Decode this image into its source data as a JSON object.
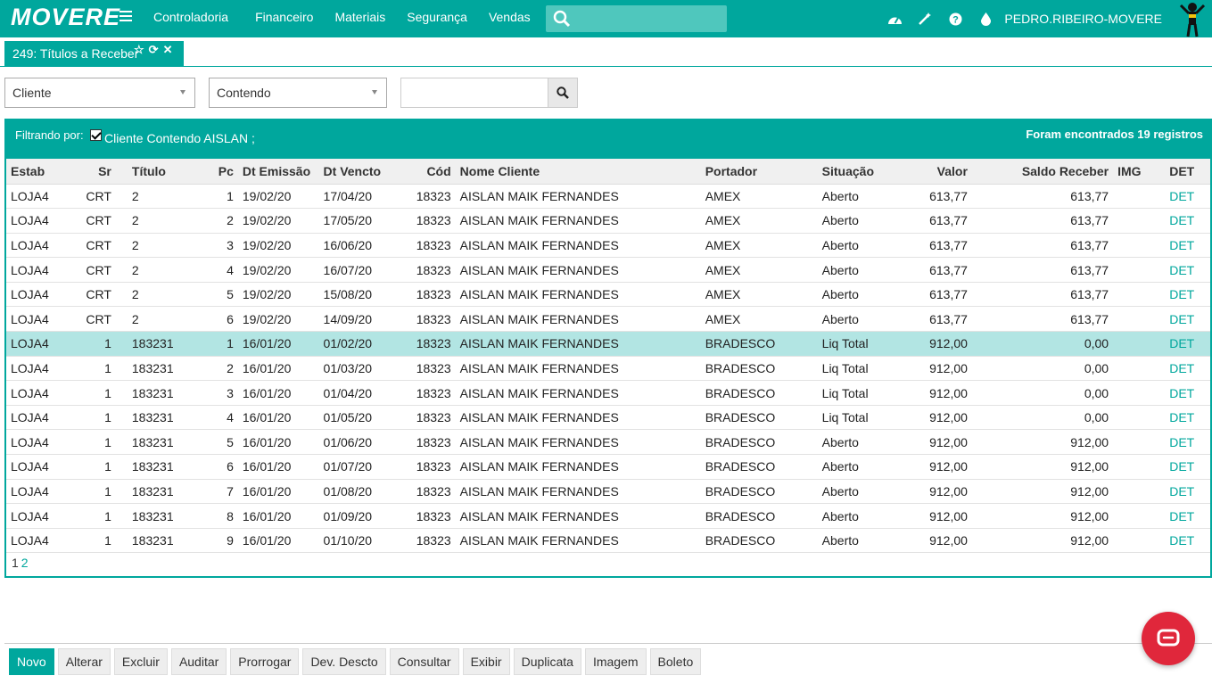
{
  "app": {
    "logo": "MOVERE",
    "user": "PEDRO.RIBEIRO-MOVERE"
  },
  "nav": {
    "items": [
      "Controladoria",
      "Financeiro",
      "Materiais",
      "Segurança",
      "Vendas"
    ],
    "search_placeholder": ""
  },
  "icons": {
    "dashboard": "dashboard-icon",
    "magic": "magic-wand-icon",
    "help": "help-icon",
    "drop": "drop-icon"
  },
  "tab": {
    "label": "249: Títulos a Receber"
  },
  "filters": {
    "field": "Cliente",
    "operator": "Contendo",
    "value": ""
  },
  "panel": {
    "filter_label": "Filtrando por:",
    "filter_chip": "Cliente Contendo AISLAN ;",
    "found": "Foram encontrados 19 registros"
  },
  "table": {
    "columns": [
      "Estab",
      "Sr",
      "Título",
      "Pc",
      "Dt Emissão",
      "Dt Vencto",
      "Cód",
      "Nome Cliente",
      "Portador",
      "Situação",
      "Valor",
      "Saldo Receber",
      "IMG",
      "DET"
    ],
    "rows": [
      [
        "LOJA4",
        "CRT",
        "2",
        "1",
        "19/02/20",
        "17/04/20",
        "18323",
        "AISLAN MAIK FERNANDES",
        "AMEX",
        "Aberto",
        "613,77",
        "613,77",
        "",
        "DET"
      ],
      [
        "LOJA4",
        "CRT",
        "2",
        "2",
        "19/02/20",
        "17/05/20",
        "18323",
        "AISLAN MAIK FERNANDES",
        "AMEX",
        "Aberto",
        "613,77",
        "613,77",
        "",
        "DET"
      ],
      [
        "LOJA4",
        "CRT",
        "2",
        "3",
        "19/02/20",
        "16/06/20",
        "18323",
        "AISLAN MAIK FERNANDES",
        "AMEX",
        "Aberto",
        "613,77",
        "613,77",
        "",
        "DET"
      ],
      [
        "LOJA4",
        "CRT",
        "2",
        "4",
        "19/02/20",
        "16/07/20",
        "18323",
        "AISLAN MAIK FERNANDES",
        "AMEX",
        "Aberto",
        "613,77",
        "613,77",
        "",
        "DET"
      ],
      [
        "LOJA4",
        "CRT",
        "2",
        "5",
        "19/02/20",
        "15/08/20",
        "18323",
        "AISLAN MAIK FERNANDES",
        "AMEX",
        "Aberto",
        "613,77",
        "613,77",
        "",
        "DET"
      ],
      [
        "LOJA4",
        "CRT",
        "2",
        "6",
        "19/02/20",
        "14/09/20",
        "18323",
        "AISLAN MAIK FERNANDES",
        "AMEX",
        "Aberto",
        "613,77",
        "613,77",
        "",
        "DET"
      ],
      [
        "LOJA4",
        "1",
        "183231",
        "1",
        "16/01/20",
        "01/02/20",
        "18323",
        "AISLAN MAIK FERNANDES",
        "BRADESCO",
        "Liq Total",
        "912,00",
        "0,00",
        "",
        "DET"
      ],
      [
        "LOJA4",
        "1",
        "183231",
        "2",
        "16/01/20",
        "01/03/20",
        "18323",
        "AISLAN MAIK FERNANDES",
        "BRADESCO",
        "Liq Total",
        "912,00",
        "0,00",
        "",
        "DET"
      ],
      [
        "LOJA4",
        "1",
        "183231",
        "3",
        "16/01/20",
        "01/04/20",
        "18323",
        "AISLAN MAIK FERNANDES",
        "BRADESCO",
        "Liq Total",
        "912,00",
        "0,00",
        "",
        "DET"
      ],
      [
        "LOJA4",
        "1",
        "183231",
        "4",
        "16/01/20",
        "01/05/20",
        "18323",
        "AISLAN MAIK FERNANDES",
        "BRADESCO",
        "Liq Total",
        "912,00",
        "0,00",
        "",
        "DET"
      ],
      [
        "LOJA4",
        "1",
        "183231",
        "5",
        "16/01/20",
        "01/06/20",
        "18323",
        "AISLAN MAIK FERNANDES",
        "BRADESCO",
        "Aberto",
        "912,00",
        "912,00",
        "",
        "DET"
      ],
      [
        "LOJA4",
        "1",
        "183231",
        "6",
        "16/01/20",
        "01/07/20",
        "18323",
        "AISLAN MAIK FERNANDES",
        "BRADESCO",
        "Aberto",
        "912,00",
        "912,00",
        "",
        "DET"
      ],
      [
        "LOJA4",
        "1",
        "183231",
        "7",
        "16/01/20",
        "01/08/20",
        "18323",
        "AISLAN MAIK FERNANDES",
        "BRADESCO",
        "Aberto",
        "912,00",
        "912,00",
        "",
        "DET"
      ],
      [
        "LOJA4",
        "1",
        "183231",
        "8",
        "16/01/20",
        "01/09/20",
        "18323",
        "AISLAN MAIK FERNANDES",
        "BRADESCO",
        "Aberto",
        "912,00",
        "912,00",
        "",
        "DET"
      ],
      [
        "LOJA4",
        "1",
        "183231",
        "9",
        "16/01/20",
        "01/10/20",
        "18323",
        "AISLAN MAIK FERNANDES",
        "BRADESCO",
        "Aberto",
        "912,00",
        "912,00",
        "",
        "DET"
      ]
    ],
    "selected_row": 6,
    "pages": [
      "1",
      "2"
    ]
  },
  "toolbar": [
    "Novo",
    "Alterar",
    "Excluir",
    "Auditar",
    "Prorrogar",
    "Dev. Descto",
    "Consultar",
    "Exibir",
    "Duplicata",
    "Imagem",
    "Boleto"
  ],
  "colors": {
    "accent": "#00a79d",
    "selected_row": "#b2e5e3",
    "chat": "#e0273b"
  }
}
